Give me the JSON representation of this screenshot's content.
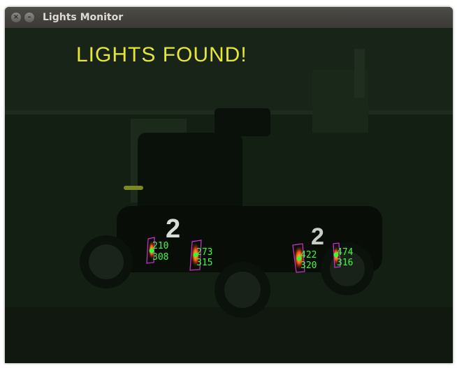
{
  "window": {
    "title": "Lights Monitor"
  },
  "status_text": "LIGHTS FOUND!",
  "detections": [
    {
      "x": "210",
      "y": "308"
    },
    {
      "x": "273",
      "y": "315"
    },
    {
      "x": "422",
      "y": "320"
    },
    {
      "x": "474",
      "y": "316"
    }
  ],
  "colors": {
    "status_text": "#e6e633",
    "label_text": "#33ff33",
    "bounding_box": "#d030d0",
    "center_dot": "#33ff33",
    "light_glow": "#ff6a10"
  },
  "icons": {
    "close": "close-icon",
    "minimize": "minimize-icon"
  }
}
